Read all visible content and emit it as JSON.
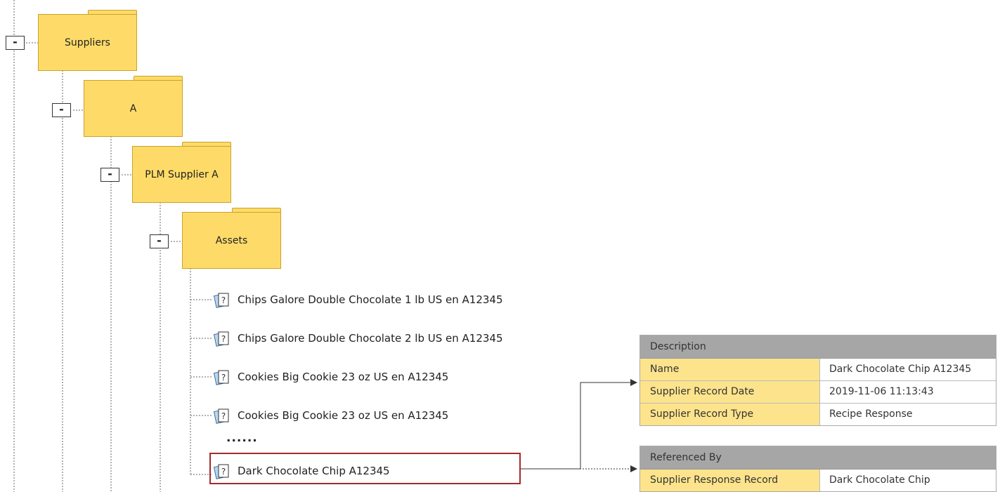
{
  "tree": {
    "folders": [
      {
        "label": "Suppliers",
        "toggle": "-"
      },
      {
        "label": "A",
        "toggle": "-"
      },
      {
        "label": "PLM Supplier A",
        "toggle": "-"
      },
      {
        "label": "Assets",
        "toggle": "-"
      }
    ],
    "assets": [
      {
        "label": "Chips Galore Double Chocolate 1 lb US en A12345",
        "icon": "unknown-document-icon"
      },
      {
        "label": "Chips Galore Double Chocolate 2 lb US en A12345",
        "icon": "unknown-document-icon"
      },
      {
        "label": "Cookies Big Cookie 23 oz US en A12345",
        "icon": "unknown-document-icon"
      },
      {
        "label": "Cookies Big Cookie 23 oz US en A12345",
        "icon": "unknown-document-icon"
      }
    ],
    "ellipsis": "......",
    "selected_asset": {
      "label": "Dark Chocolate Chip A12345",
      "icon": "unknown-document-icon"
    }
  },
  "description_panel": {
    "title": "Description",
    "rows": [
      {
        "key": "Name",
        "value": "Dark Chocolate Chip A12345"
      },
      {
        "key": "Supplier Record Date",
        "value": "2019-11-06 11:13:43"
      },
      {
        "key": "Supplier Record Type",
        "value": "Recipe Response"
      }
    ]
  },
  "referenced_panel": {
    "title": "Referenced By",
    "rows": [
      {
        "key": "Supplier Response Record",
        "value": "Dark Chocolate Chip"
      }
    ]
  },
  "colors": {
    "folder": "#fedb69",
    "panel_key": "#fde48c",
    "panel_header": "#a6a6a6",
    "highlight": "#a52a2a"
  }
}
